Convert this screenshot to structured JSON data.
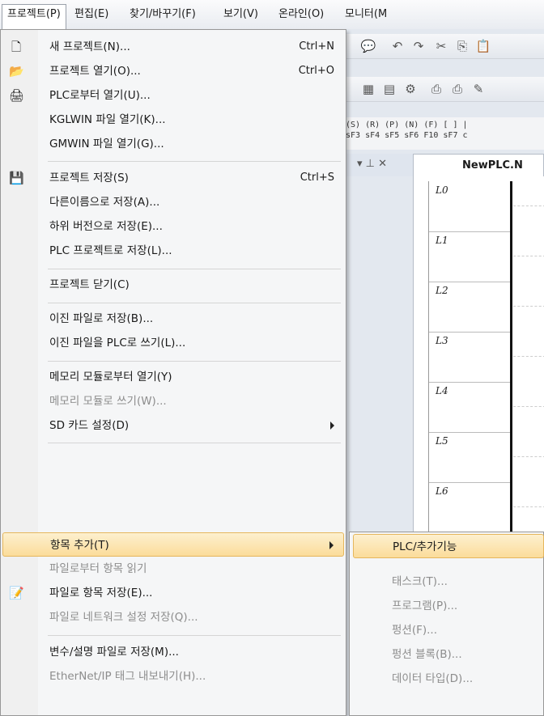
{
  "menubar": {
    "items": [
      "프로젝트(P)",
      "편집(E)",
      "찾기/바꾸기(F)",
      "보기(V)",
      "온라인(O)",
      "모니터(M"
    ]
  },
  "fkeys": {
    "row1": "(S) (R) (P) (N) (F) [ ] |",
    "row2": "sF3 sF4 sF5 sF6 F10 sF7 c"
  },
  "editor": {
    "panel_controls": "▾ ⊥ ✕",
    "tab_title": "NewPLC.N",
    "rungs": [
      "L0",
      "L1",
      "L2",
      "L3",
      "L4",
      "L5",
      "L6"
    ]
  },
  "project_menu": {
    "items": [
      {
        "label": "새 프로젝트(N)...",
        "shortcut": "Ctrl+N",
        "icon": "new-file-icon"
      },
      {
        "label": "프로젝트 열기(O)...",
        "shortcut": "Ctrl+O",
        "icon": "open-folder-icon"
      },
      {
        "label": "PLC로부터 열기(U)...",
        "shortcut": "",
        "icon": "plc-open-icon"
      },
      {
        "label": "KGLWIN 파일 열기(K)...",
        "shortcut": ""
      },
      {
        "label": "GMWIN 파일 열기(G)...",
        "shortcut": ""
      },
      {
        "label": "프로젝트 저장(S)",
        "shortcut": "Ctrl+S",
        "icon": "save-icon"
      },
      {
        "label": "다른이름으로 저장(A)...",
        "shortcut": ""
      },
      {
        "label": "하위 버전으로 저장(E)...",
        "shortcut": ""
      },
      {
        "label": "PLC 프로젝트로 저장(L)...",
        "shortcut": ""
      },
      {
        "label": "프로젝트 닫기(C)",
        "shortcut": ""
      },
      {
        "label": "이진 파일로 저장(B)...",
        "shortcut": ""
      },
      {
        "label": "이진 파일을 PLC로 쓰기(L)...",
        "shortcut": ""
      },
      {
        "label": "메모리 모듈로부터 열기(Y)",
        "shortcut": ""
      },
      {
        "label": "메모리 모듈로 쓰기(W)...",
        "shortcut": "",
        "disabled": true
      },
      {
        "label": "SD 카드 설정(D)",
        "shortcut": "",
        "submenu": true
      },
      {
        "label": "항목 추가(T)",
        "shortcut": "",
        "submenu": true,
        "highlighted": true
      },
      {
        "label": "파일로부터 항목 읽기",
        "shortcut": "",
        "disabled": true
      },
      {
        "label": "파일로 항목 저장(E)...",
        "shortcut": "",
        "icon": "export-icon"
      },
      {
        "label": "파일로 네트워크 설정 저장(Q)...",
        "shortcut": "",
        "disabled": true
      },
      {
        "label": "변수/설명 파일로 저장(M)...",
        "shortcut": ""
      },
      {
        "label": "EtherNet/IP 태그 내보내기(H)...",
        "shortcut": "",
        "disabled": true
      }
    ]
  },
  "add_item_submenu": {
    "items": [
      {
        "label": "PLC/추가기능",
        "highlighted": true
      },
      {
        "label": "태스크(T)...",
        "disabled": true
      },
      {
        "label": "프로그램(P)...",
        "disabled": true
      },
      {
        "label": "펑션(F)...",
        "disabled": true
      },
      {
        "label": "펑션 블록(B)...",
        "disabled": true
      },
      {
        "label": "데이터 타입(D)...",
        "disabled": true
      }
    ]
  }
}
